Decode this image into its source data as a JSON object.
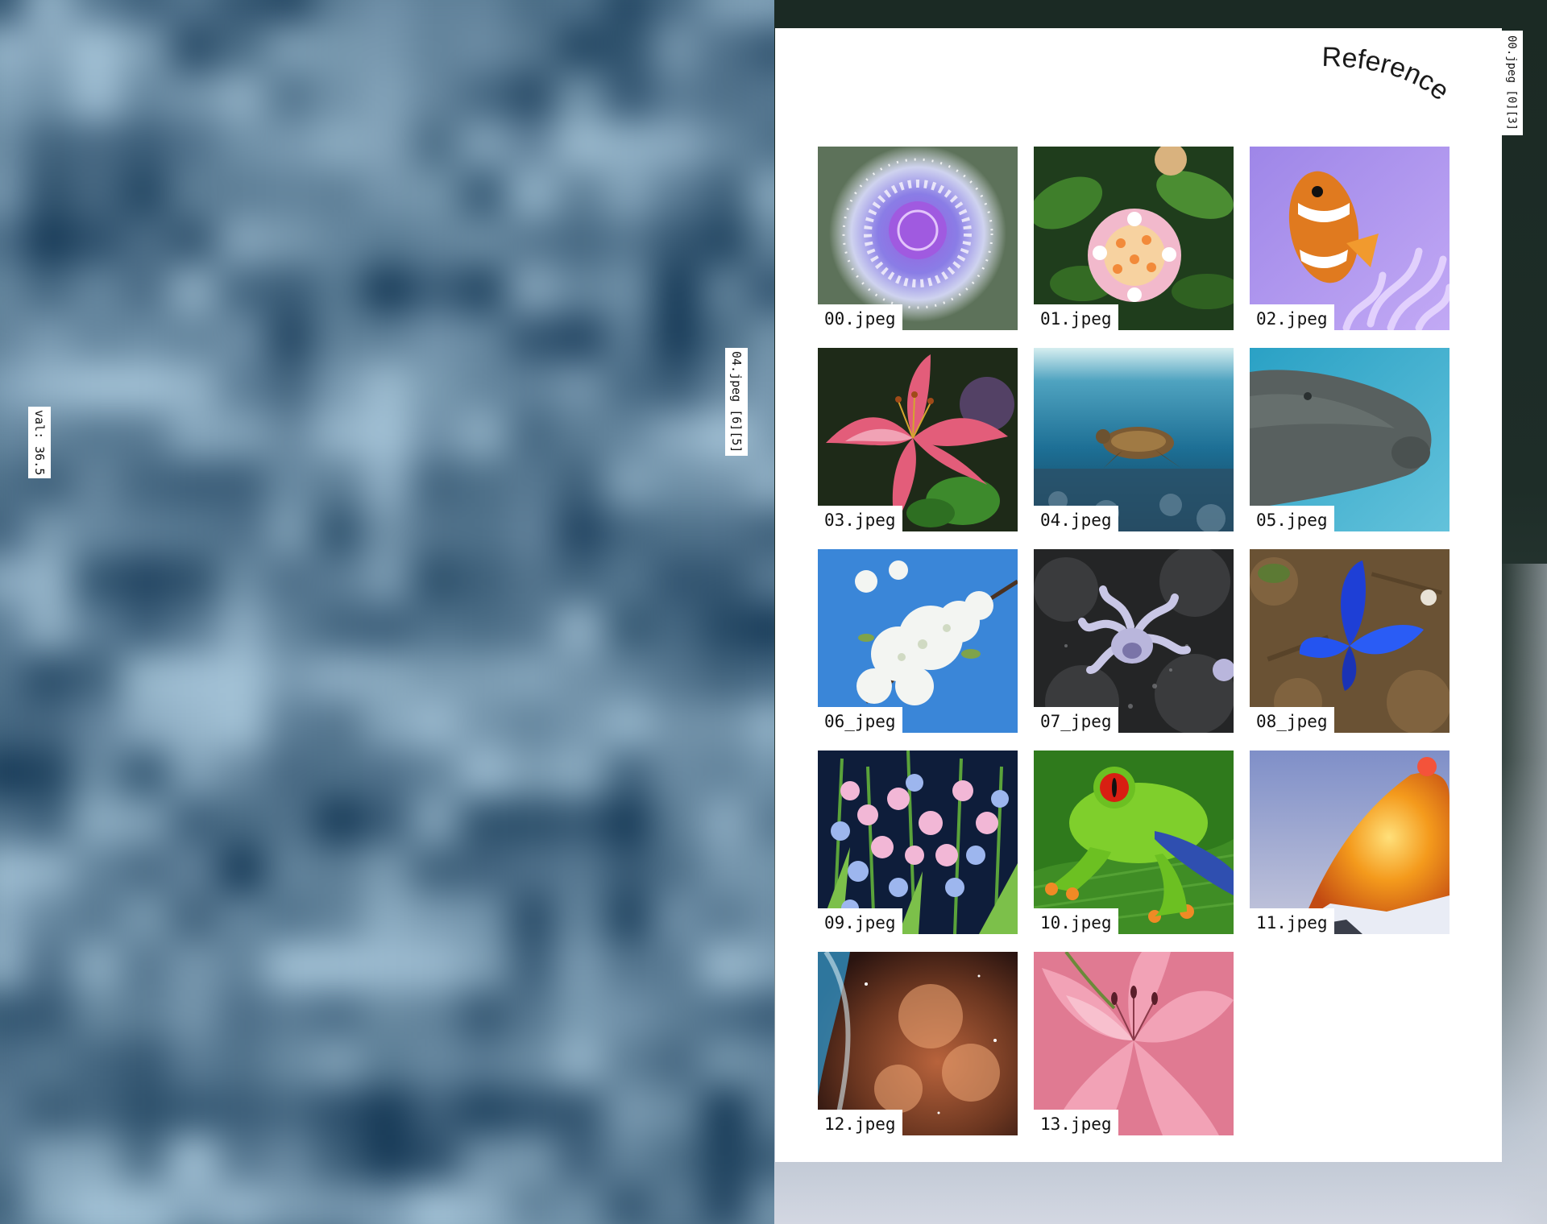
{
  "viewer": {
    "value_label": "val: 36.5",
    "zoom_label": "04.jpeg [6][5]",
    "corner_label": "00.jpeg [0][3]"
  },
  "reference": {
    "title": "Reference",
    "items": [
      {
        "label": "00.jpeg",
        "subject": "jellyfish"
      },
      {
        "label": "01.jpeg",
        "subject": "lantana-flower"
      },
      {
        "label": "02.jpeg",
        "subject": "clownfish"
      },
      {
        "label": "03.jpeg",
        "subject": "lily"
      },
      {
        "label": "04.jpeg",
        "subject": "sea-turtle"
      },
      {
        "label": "05.jpeg",
        "subject": "manatee"
      },
      {
        "label": "06_jpeg",
        "subject": "cherry-blossom"
      },
      {
        "label": "07_jpeg",
        "subject": "octopus"
      },
      {
        "label": "08_jpeg",
        "subject": "blue-butterfly"
      },
      {
        "label": "09.jpeg",
        "subject": "lily-of-the-valley"
      },
      {
        "label": "10.jpeg",
        "subject": "tree-frog"
      },
      {
        "label": "11.jpeg",
        "subject": "volcano"
      },
      {
        "label": "12.jpeg",
        "subject": "nebula"
      },
      {
        "label": "13.jpeg",
        "subject": "pink-lily"
      }
    ]
  },
  "colors": {
    "sheet": "#ffffff",
    "backdrop_dark": "#1b2a24",
    "backdrop_light": "#d3d7e2",
    "water_dark": "#173a57",
    "water_light": "#a3c2d6"
  }
}
